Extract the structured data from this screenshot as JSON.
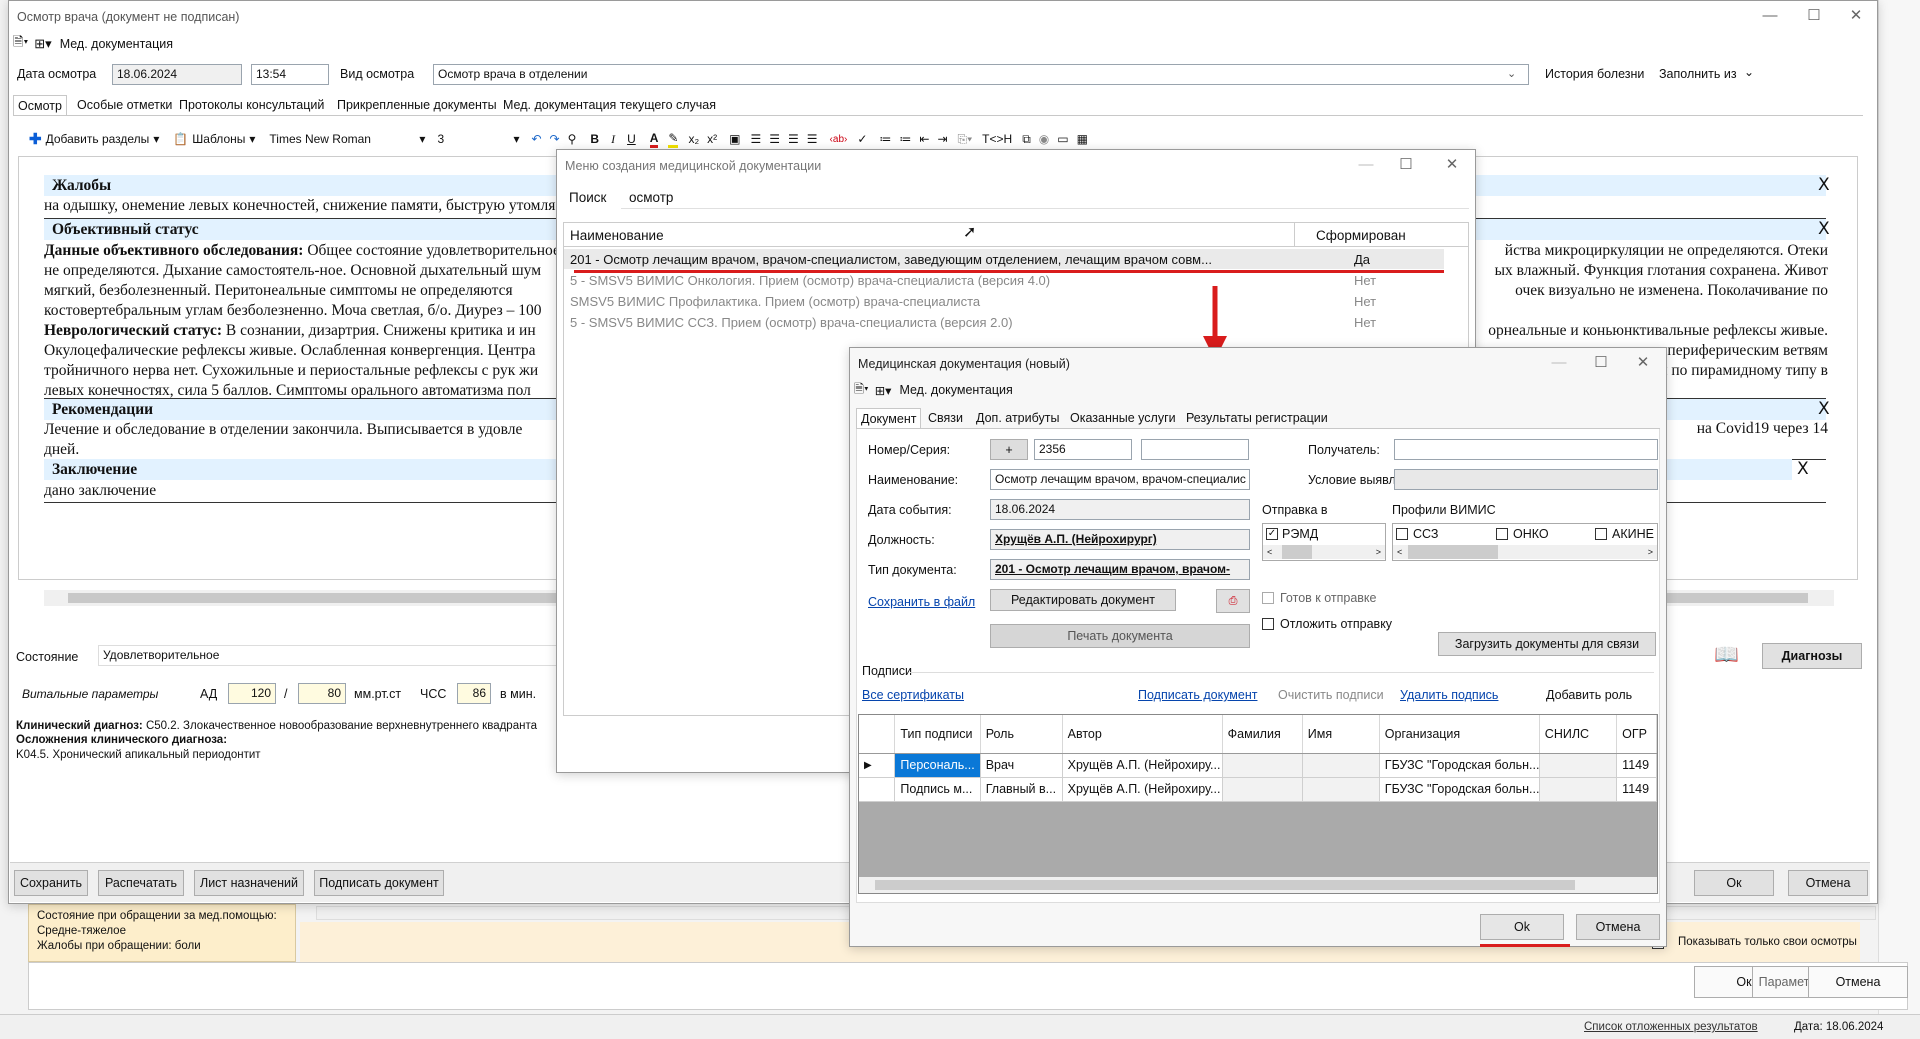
{
  "main": {
    "title": "Осмотр врача (документ не подписан)",
    "menu_label": "Мед. документация",
    "exam_date_label": "Дата осмотра",
    "exam_date": "18.06.2024",
    "exam_time": "13:54",
    "exam_type_label": "Вид осмотра",
    "exam_type": "Осмотр врача в отделении",
    "history_label": "История болезни",
    "fill_from_label": "Заполнить из",
    "tabs": [
      "Осмотр",
      "Особые отметки",
      "Протоколы консультаций",
      "Прикрепленные документы",
      "Мед. документация текущего случая"
    ],
    "toolbar": {
      "add_sections": "Добавить разделы",
      "templates": "Шаблоны",
      "font": "Times New Roman",
      "size": "3",
      "tag_label": "T<>H"
    },
    "doc": {
      "s1_title": "Жалобы",
      "s1_text": "на одышку, онемение левых конечностей, снижение памяти, быструю утомляемость",
      "s2_title": "Объективный статус",
      "s2_p1_bold": "Данные объективного обследования:",
      "s2_p1": " Общее состояние удовлетворительное. Сознание ясное. Кожные покровы чистые, обычной окраски. Нарушения микроциркуляции не определяются. Отеки",
      "s2_p1_right": "йства микроциркуляции не определяются. Отеки",
      "s2_l2": "не определяются. Дыхание самостоятель-ное. Основной дыхательный шум",
      "s2_l2_right": "ых влажный. Функция глотания сохранена. Живот",
      "s2_l3": "мягкий, безболезненный. Перитонеальные симптомы не определяются",
      "s2_l3_right": "очек визуально не изменена. Поколачивание по",
      "s2_l4": "костовертебральным углам безболезненно. Моча светлая, б/о. Диурез – 100",
      "s2_p2_bold": "Неврологический статус:",
      "s2_p2": " В сознании, дизартрия. Снижены критика и ин",
      "s2_p2_right": "орнеальные и коньюнктивальные рефлексы живые.",
      "s2_l6": "Окулоцефалические рефлексы живые. Ослабленная конвергенция. Центра",
      "s2_l6_right": "по сегментарному типу и периферическим ветвям",
      "s2_l7": "тройничного нерва нет. Сухожильные и периостальные рефлексы с рук жи",
      "s2_l7_right": "ропы по пирамидному типу в",
      "s2_l8": "левых конечностях, сила 5 баллов. Симптомы орального автоматизма пол",
      "s3_title": "Рекомендации",
      "s3_text": "Лечение и обследование в отделении закончила. Выписывается в удовле",
      "s3_right": "на Covid19 через 14",
      "s3_l2": "дней.",
      "s4_title": "Заключение",
      "s4_text": "дано заключение",
      "close_x": "X"
    },
    "state_label": "Состояние",
    "state_value": "Удовлетворительное",
    "vitals_label": "Витальные параметры",
    "ad_label": "АД",
    "ad_sys": "120",
    "ad_sep": "/",
    "ad_dia": "80",
    "ad_unit": "мм.рт.ст",
    "hr_label": "ЧСС",
    "hr_value": "86",
    "hr_unit": "в мин.",
    "diag_line1_bold": "Клинический диагноз:",
    "diag_line1": " C50.2. Злокачественное новообразование верхневнутреннего квадранта",
    "diag_line2": "Осложнения клинического диагноза:",
    "diag_line3": "K04.5. Хронический апикальный периодонтит",
    "diagnoses_btn": "Диагнозы",
    "buttons": {
      "save": "Сохранить",
      "print": "Распечатать",
      "prescriptions": "Лист назначений",
      "sign": "Подписать документ",
      "ok": "Ок",
      "cancel": "Отмена"
    }
  },
  "bg": {
    "admission_state": "Состояние при обращении за мед.помощью: Средне-тяжелое",
    "complaints": "Жалобы при обращении: боли",
    "only_mine": "Показывать только свои осмотры",
    "ok": "Ок",
    "params": "Параметры",
    "cancel": "Отмена",
    "deferred_link": "Список отложенных результатов",
    "status_date": "Дата: 18.06.2024"
  },
  "menu_dialog": {
    "title": "Меню создания медицинской документации",
    "search_label": "Поиск",
    "search_value": "осмотр",
    "col_name": "Наименование",
    "col_formed": "Сформирован",
    "rows": [
      {
        "name": "201 - Осмотр лечащим врачом, врачом-специалистом, заведующим отделением, лечащим врачом совм...",
        "formed": "Да"
      },
      {
        "name": "5 - SMSV5 ВИМИС Онкология. Прием (осмотр) врача-специалиста (версия 4.0)",
        "formed": "Нет"
      },
      {
        "name": "SMSV5 ВИМИС Профилактика. Прием (осмотр) врача-специалиста",
        "formed": "Нет"
      },
      {
        "name": "5 - SMSV5 ВИМИС ССЗ. Прием (осмотр) врача-специалиста (версия 2.0)",
        "formed": "Нет"
      }
    ]
  },
  "doc_dialog": {
    "title": "Медицинская документация (новый)",
    "menu_label": "Мед. документация",
    "tabs": [
      "Документ",
      "Связи",
      "Доп. атрибуты",
      "Оказанные услуги",
      "Результаты регистрации"
    ],
    "number_label": "Номер/Серия:",
    "plus": "+",
    "number": "2356",
    "series": "",
    "name_label": "Наименование:",
    "name_value": "Осмотр лечащим врачом, врачом-специалис",
    "event_date_label": "Дата события:",
    "event_date": "18.06.2024",
    "position_label": "Должность:",
    "position_value": "Хрущёв А.П. (Нейрохирург)",
    "doctype_label": "Тип документа:",
    "doctype_value": "201 - Осмотр лечащим врачом, врачом-",
    "save_file": "Сохранить в файл",
    "edit_doc": "Редактировать документ",
    "print_doc": "Печать документа",
    "recipient_label": "Получатель:",
    "condition_label": "Условие выявления:",
    "send_to_label": "Отправка в",
    "remd": "РЭМД",
    "profiles_label": "Профили ВИМИС",
    "p1": "ССЗ",
    "p2": "ОНКО",
    "p3": "АКИНЕ",
    "ready_label": "Готов к отправке",
    "defer_label": "Отложить отправку",
    "load_docs": "Загрузить документы для связи",
    "signatures_label": "Подписи",
    "all_certs": "Все сертификаты",
    "sign_doc": "Подписать документ",
    "clear_sigs": "Очистить подписи",
    "delete_sig": "Удалить подпись",
    "add_role": "Добавить роль",
    "cols": [
      "Тип подписи",
      "Роль",
      "Автор",
      "Фамилия",
      "Имя",
      "Организация",
      "СНИЛС",
      "ОГР"
    ],
    "rows": [
      [
        "Персональ...",
        "Врач",
        "Хрущёв А.П. (Нейрохиру...",
        "",
        "",
        "ГБУЗС \"Городская больн...",
        "",
        "1149"
      ],
      [
        "Подпись м...",
        "Главный в...",
        "Хрущёв А.П. (Нейрохиру...",
        "",
        "",
        "ГБУЗС \"Городская больн...",
        "",
        "1149"
      ]
    ],
    "ok": "Ok",
    "cancel": "Отмена"
  },
  "colors": {
    "accent_red": "#d91c1c",
    "section_bg": "#e2f2ff",
    "selected_cell": "#0a78d7",
    "highlight_input": "#fffbe0"
  }
}
